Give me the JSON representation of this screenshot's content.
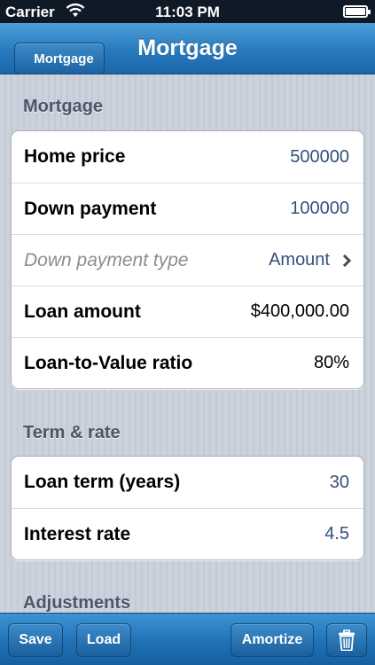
{
  "status_bar": {
    "carrier": "Carrier",
    "time": "11:03 PM",
    "battery_level": 1.0
  },
  "nav": {
    "back_label": "Mortgage",
    "title": "Mortgage"
  },
  "sections": [
    {
      "header": "Mortgage",
      "rows": [
        {
          "label": "Home price",
          "value": "500000"
        },
        {
          "label": "Down payment",
          "value": "100000"
        },
        {
          "label": "Down payment type",
          "value": "Amount"
        },
        {
          "label": "Loan amount",
          "value": "$400,000.00"
        },
        {
          "label": "Loan-to-Value ratio",
          "value": "80%"
        }
      ]
    },
    {
      "header": "Term & rate",
      "rows": [
        {
          "label": "Loan term (years)",
          "value": "30"
        },
        {
          "label": "Interest rate",
          "value": "4.5"
        }
      ]
    },
    {
      "header": "Adjustments",
      "rows": []
    }
  ],
  "toolbar": {
    "save_label": "Save",
    "load_label": "Load",
    "amortize_label": "Amortize",
    "delete_icon": "trash-icon"
  }
}
